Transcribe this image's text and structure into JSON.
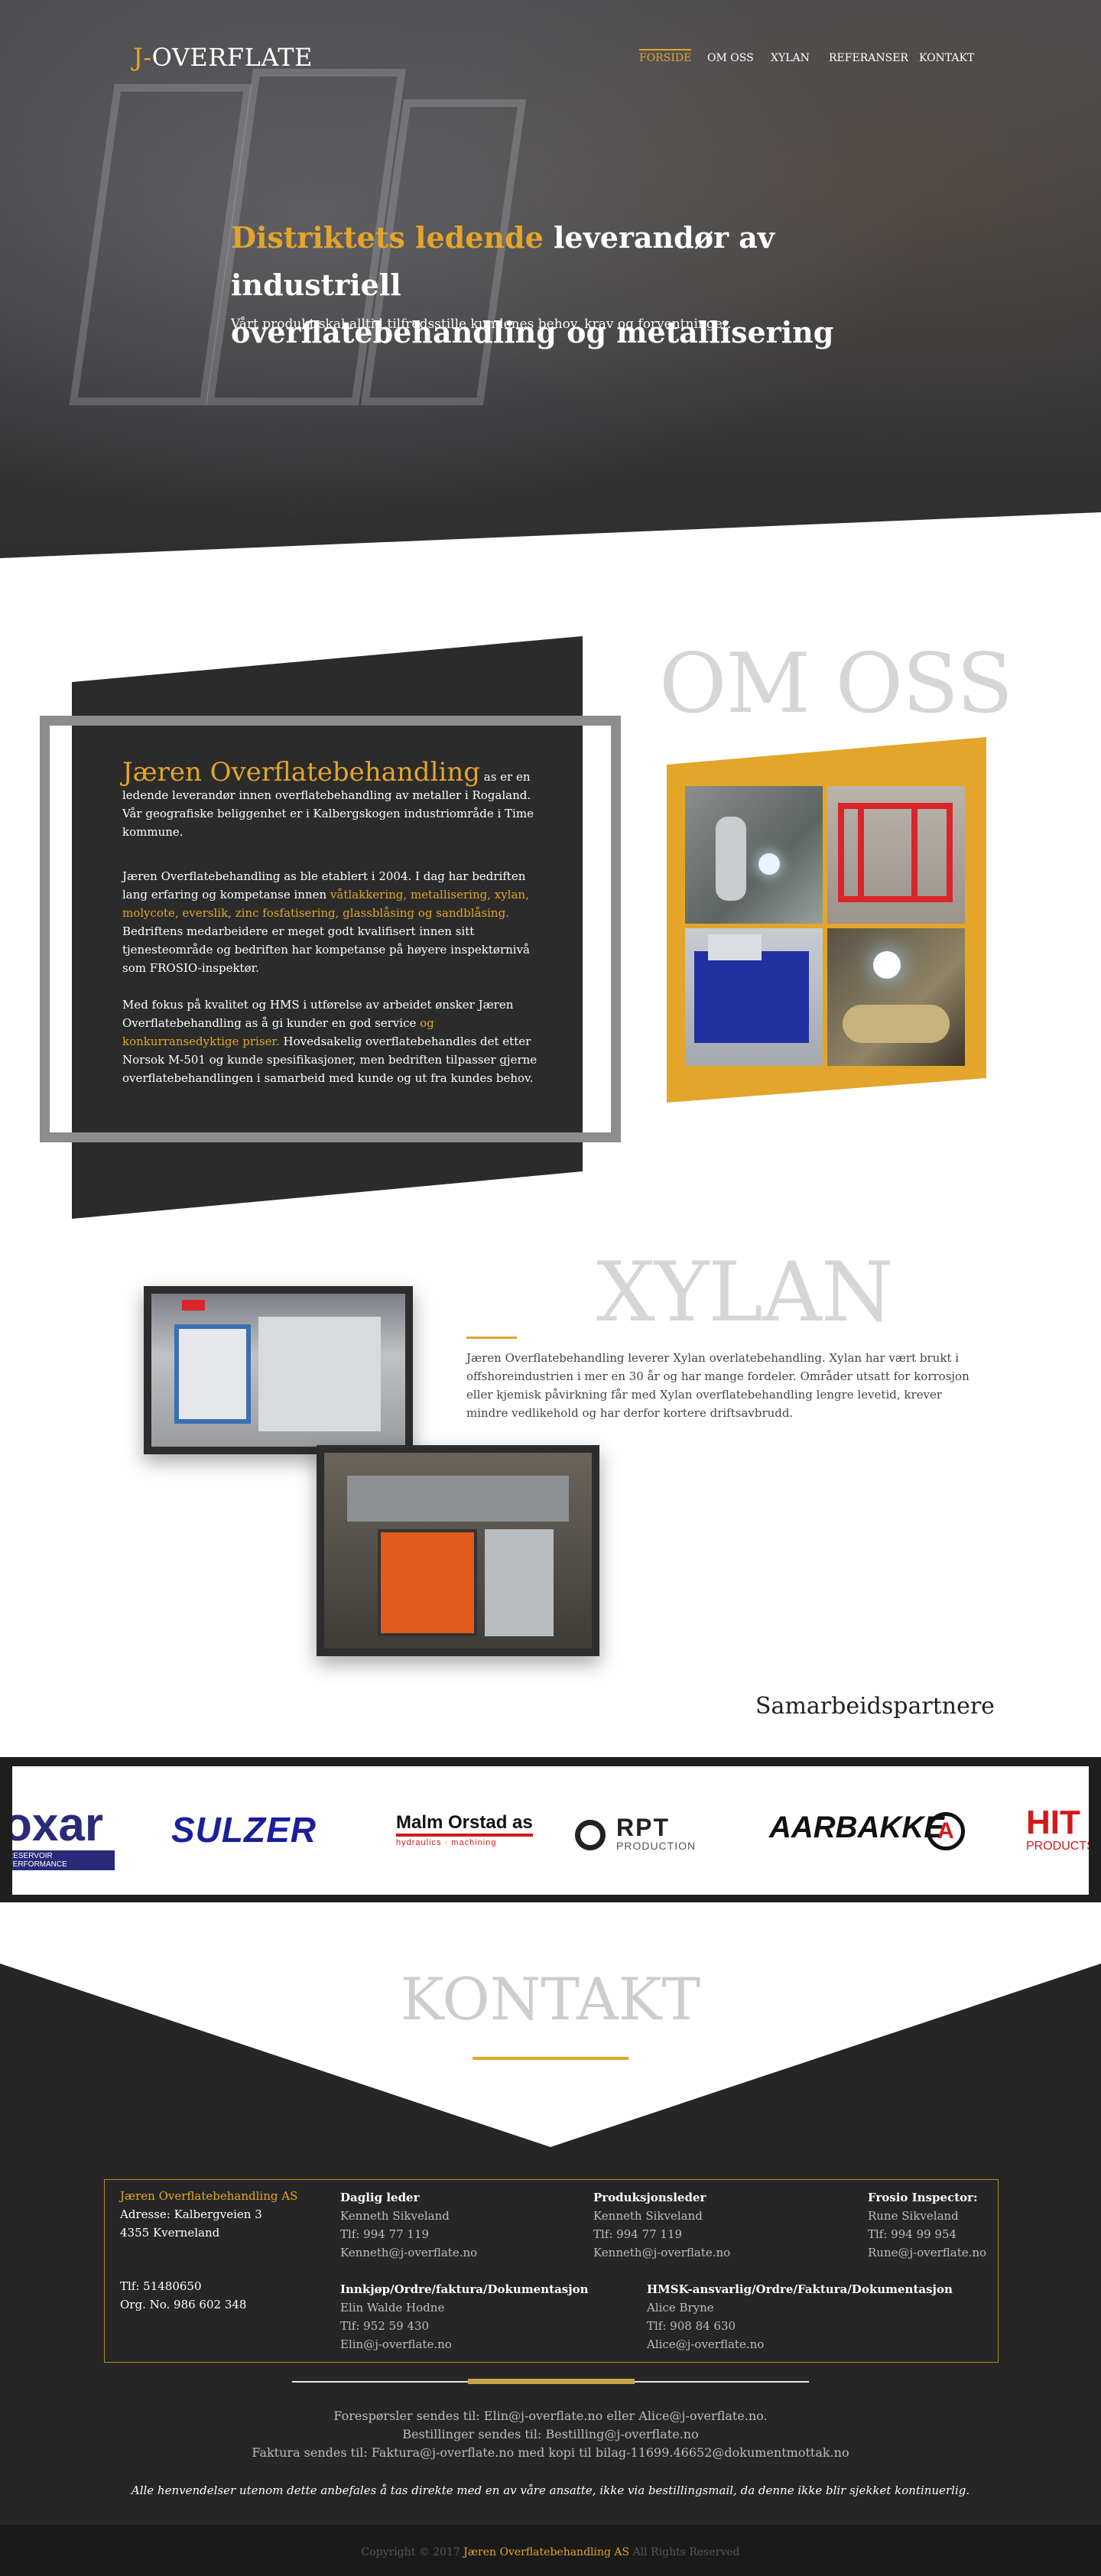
{
  "brand": {
    "logo_prefix": "J-",
    "logo_suffix": "OVERFLATE"
  },
  "nav": [
    {
      "label": "FORSIDE",
      "active": true
    },
    {
      "label": "OM OSS",
      "active": false
    },
    {
      "label": "XYLAN",
      "active": false
    },
    {
      "label": "REFERANSER",
      "active": false
    },
    {
      "label": "KONTAKT",
      "active": false
    }
  ],
  "hero": {
    "headline_accent": "Distriktets ledende",
    "headline_rest_1": " leverandør av industriell",
    "headline_line_2": "overflatebehandling og metallisering",
    "subtitle": "Vårt produkt skal alltid tilfredsstille kundenes behov, krav og forventninger."
  },
  "om_oss": {
    "title": "OM OSS",
    "company_name": "Jæren Overflatebehandling",
    "intro_rest": " as  er en ledende leverandør innen overflatebehandling av metaller i Rogaland. Vår geografiske beliggenhet er i Kalbergskogen industriområde i Time kommune.",
    "p2_a": "Jæren Overflatebehandling as ble etablert i 2004. I dag har bedriften lang erfaring og kompetanse innen ",
    "p2_accent": "våtlakkering, metallisering, xylan, molycote, everslik, zinc fosfatisering, glassblåsing og sandblåsing.",
    "p2_b": " Bedriftens medarbeidere er meget godt kvalifisert innen sitt tjenesteområde og bedriften har kompetanse på høyere inspektørnivå som FROSIO-inspektør.",
    "p3_a": "Med fokus på kvalitet og HMS i utførelse av arbeidet ønsker Jæren Overflatebehandling as å gi kunder en god service ",
    "p3_accent": "og konkurransedyktige priser.",
    "p3_b": " Hovedsakelig overflatebehandles det etter Norsok M-501 og kunde spesifikasjoner, men bedriften tilpasser gjerne overflatebehandlingen i samarbeid med kunde og ut fra kundes behov."
  },
  "xylan": {
    "title": "XYLAN",
    "text": "Jæren Overflatebehandling leverer Xylan overlatebehandling. Xylan har vært brukt i offshoreindustrien i mer en 30 år og har mange fordeler. Områder utsatt for korrosjon eller kjemisk påvirkning får med Xylan overflatebehandling lengre levetid, krever mindre vedlikehold og har derfor kortere driftsavbrudd."
  },
  "partners": {
    "title": "Samarbeidspartnere",
    "logos": [
      {
        "name": "oxar",
        "text": "oxar",
        "sub": "RESERVOIR PERFORMANCE",
        "color": "#2a2a7a"
      },
      {
        "name": "sulzer",
        "text": "SULZER",
        "color": "#1a1f9a"
      },
      {
        "name": "malm-orstad",
        "text": "Malm Orstad as",
        "sub": "hydraulics · machining",
        "color": "#111111"
      },
      {
        "name": "rpt",
        "text": "RPT",
        "sub": "PRODUCTION",
        "color": "#222222"
      },
      {
        "name": "aarbakke",
        "text": "AARBAKKE",
        "color": "#111111"
      },
      {
        "name": "hit",
        "text": "HIT",
        "sub": "PRODUCTS",
        "color": "#d21a1a"
      }
    ]
  },
  "kontakt": {
    "title": "KONTAKT",
    "company": "Jæren Overflatebehandling AS",
    "address_1": "Adresse: Kalbergveien 3",
    "address_2": "4355 Kverneland",
    "phone": "Tlf: 51480650",
    "org": "Org. No. 986 602 348",
    "daglig_title": "Daglig leder",
    "daglig_name": "Kenneth Sikveland",
    "daglig_phone": "Tlf: 994 77 119",
    "daglig_email": "Kenneth@j-overflate.no",
    "prod_title": "Produksjonsleder",
    "prod_name": "Kenneth Sikveland",
    "prod_phone": "Tlf: 994 77 119",
    "prod_email": "Kenneth@j-overflate.no",
    "frosio_title": "Frosio Inspector:",
    "frosio_name": "Rune Sikveland",
    "frosio_phone": "Tlf: 994 99 954",
    "frosio_email": "Rune@j-overflate.no",
    "innkjop_title": "Innkjøp/Ordre/faktura/Dokumentasjon",
    "innkjop_name": "Elin Walde Hodne",
    "innkjop_phone": "Tlf: 952 59 430",
    "innkjop_email": "Elin@j-overflate.no",
    "hmsk_title": "HMSK-ansvarlig/Ordre/Faktura/Dokumentasjon",
    "hmsk_name": "Alice Bryne",
    "hmsk_phone": "Tlf: 908 84 630",
    "hmsk_email": "Alice@j-overflate.no",
    "info_1": "Forespørsler sendes til: Elin@j-overflate.no eller Alice@j-overflate.no.",
    "info_2": "Bestillinger sendes til: Bestilling@j-overflate.no",
    "info_3": "Faktura sendes til: Faktura@j-overflate.no med kopi til bilag-11699.46652@dokumentmottak.no",
    "note": "Alle henvendelser utenom dette anbefales å tas direkte med en av våre ansatte, ikke via bestillingsmail, da denne ikke blir sjekket kontinuerlig."
  },
  "footer": {
    "copyright_pre": "Copyright © 2017 ",
    "copyright_company": "Jæren Overflatebehandling AS",
    "copyright_post": " All Rights Reserved"
  },
  "colors": {
    "accent": "#e3a52a",
    "dark": "#262626",
    "grey_title": "#d6d6d6"
  }
}
